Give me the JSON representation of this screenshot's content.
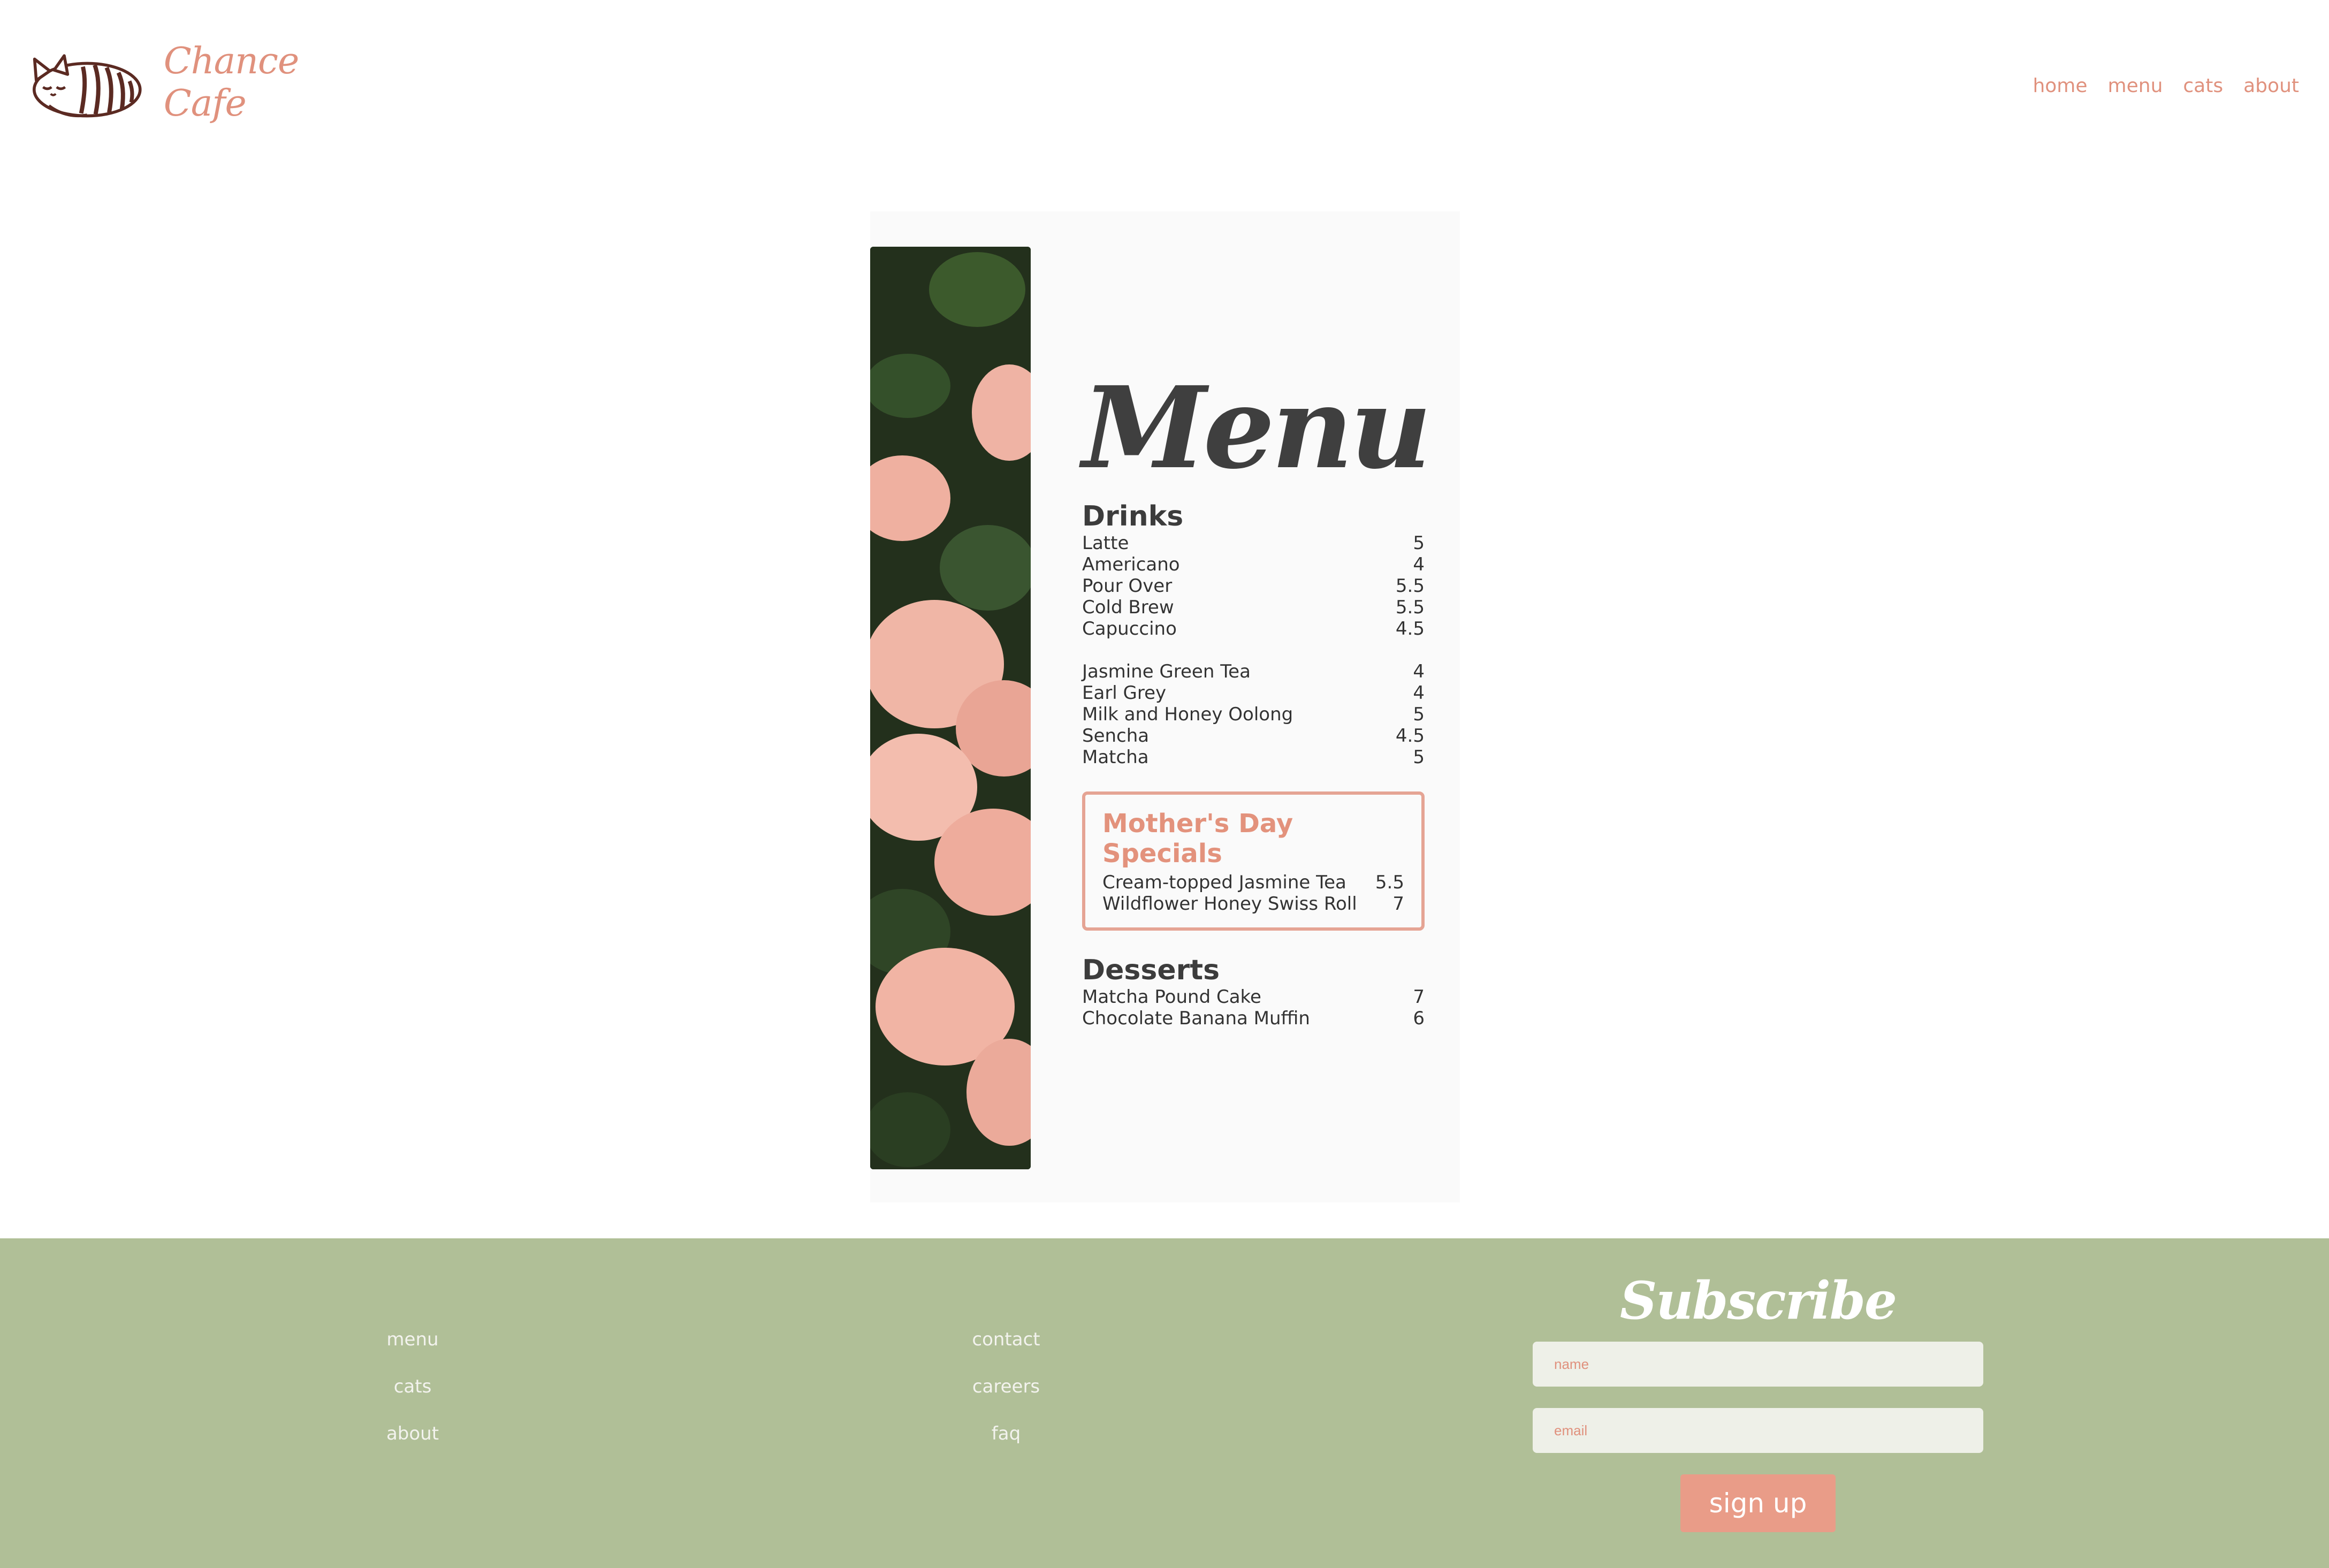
{
  "brand": {
    "name": "Chance Cafe",
    "logo_icon": "sleeping-cat-icon"
  },
  "nav": {
    "items": [
      "home",
      "menu",
      "cats",
      "about"
    ]
  },
  "menu": {
    "title": "Menu",
    "drinks": {
      "title": "Drinks",
      "coffee": [
        {
          "name": "Latte",
          "price": "5"
        },
        {
          "name": "Americano",
          "price": "4"
        },
        {
          "name": "Pour Over",
          "price": "5.5"
        },
        {
          "name": "Cold Brew",
          "price": "5.5"
        },
        {
          "name": "Capuccino",
          "price": "4.5"
        }
      ],
      "tea": [
        {
          "name": "Jasmine Green Tea",
          "price": "4"
        },
        {
          "name": "Earl Grey",
          "price": "4"
        },
        {
          "name": "Milk and Honey Oolong",
          "price": "5"
        },
        {
          "name": "Sencha",
          "price": "4.5"
        },
        {
          "name": "Matcha",
          "price": "5"
        }
      ]
    },
    "specials": {
      "title": "Mother's Day Specials",
      "items": [
        {
          "name": "Cream-topped Jasmine Tea",
          "price": "5.5"
        },
        {
          "name": "Wildflower Honey Swiss Roll",
          "price": "7"
        }
      ]
    },
    "desserts": {
      "title": "Desserts",
      "items": [
        {
          "name": "Matcha Pound Cake",
          "price": "7"
        },
        {
          "name": "Chocolate Banana Muffin",
          "price": "6"
        }
      ]
    }
  },
  "footer": {
    "col1": [
      "menu",
      "cats",
      "about"
    ],
    "col2": [
      "contact",
      "careers",
      "faq"
    ],
    "subscribe": {
      "title": "Subscribe",
      "name_placeholder": "name",
      "email_placeholder": "email",
      "button": "sign up"
    }
  },
  "colors": {
    "accent": "#e0917d",
    "footer_bg": "#b0bf97",
    "button": "#e99c88",
    "text_dark": "#3f3f3f"
  }
}
